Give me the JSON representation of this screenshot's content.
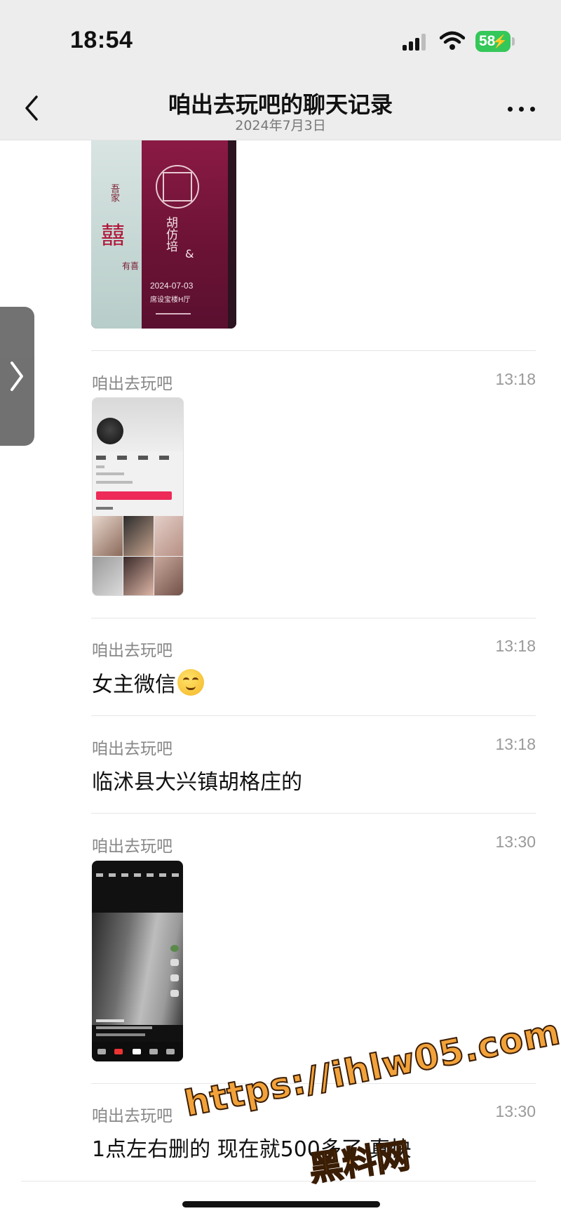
{
  "status_bar": {
    "time": "18:54",
    "battery": "58"
  },
  "nav": {
    "title": "咱出去玩吧的聊天记录",
    "date": "2024年7月3日"
  },
  "invite_image": {
    "left_text": "吾家",
    "xi": "囍",
    "left_text2": "有喜",
    "names": "胡仿培",
    "amp": "&",
    "date": "2024-07-03",
    "venue": "席设宝楼H厅"
  },
  "messages": [
    {
      "sender": "咱出去玩吧",
      "time": "13:18",
      "type": "image"
    },
    {
      "sender": "咱出去玩吧",
      "time": "13:18",
      "text": "女主微信"
    },
    {
      "sender": "咱出去玩吧",
      "time": "13:18",
      "text": "临沭县大兴镇胡格庄的"
    },
    {
      "sender": "咱出去玩吧",
      "time": "13:30",
      "type": "image"
    },
    {
      "sender": "咱出去玩吧",
      "time": "13:30",
      "text": "1点左右删的 现在就500多了 真快"
    }
  ],
  "watermark": {
    "url": "https://ihlw05.com",
    "name": "黑料网"
  },
  "colors": {
    "nav_bg": "#ededed",
    "battery": "#34c759",
    "watermark": "#f2a23a"
  }
}
